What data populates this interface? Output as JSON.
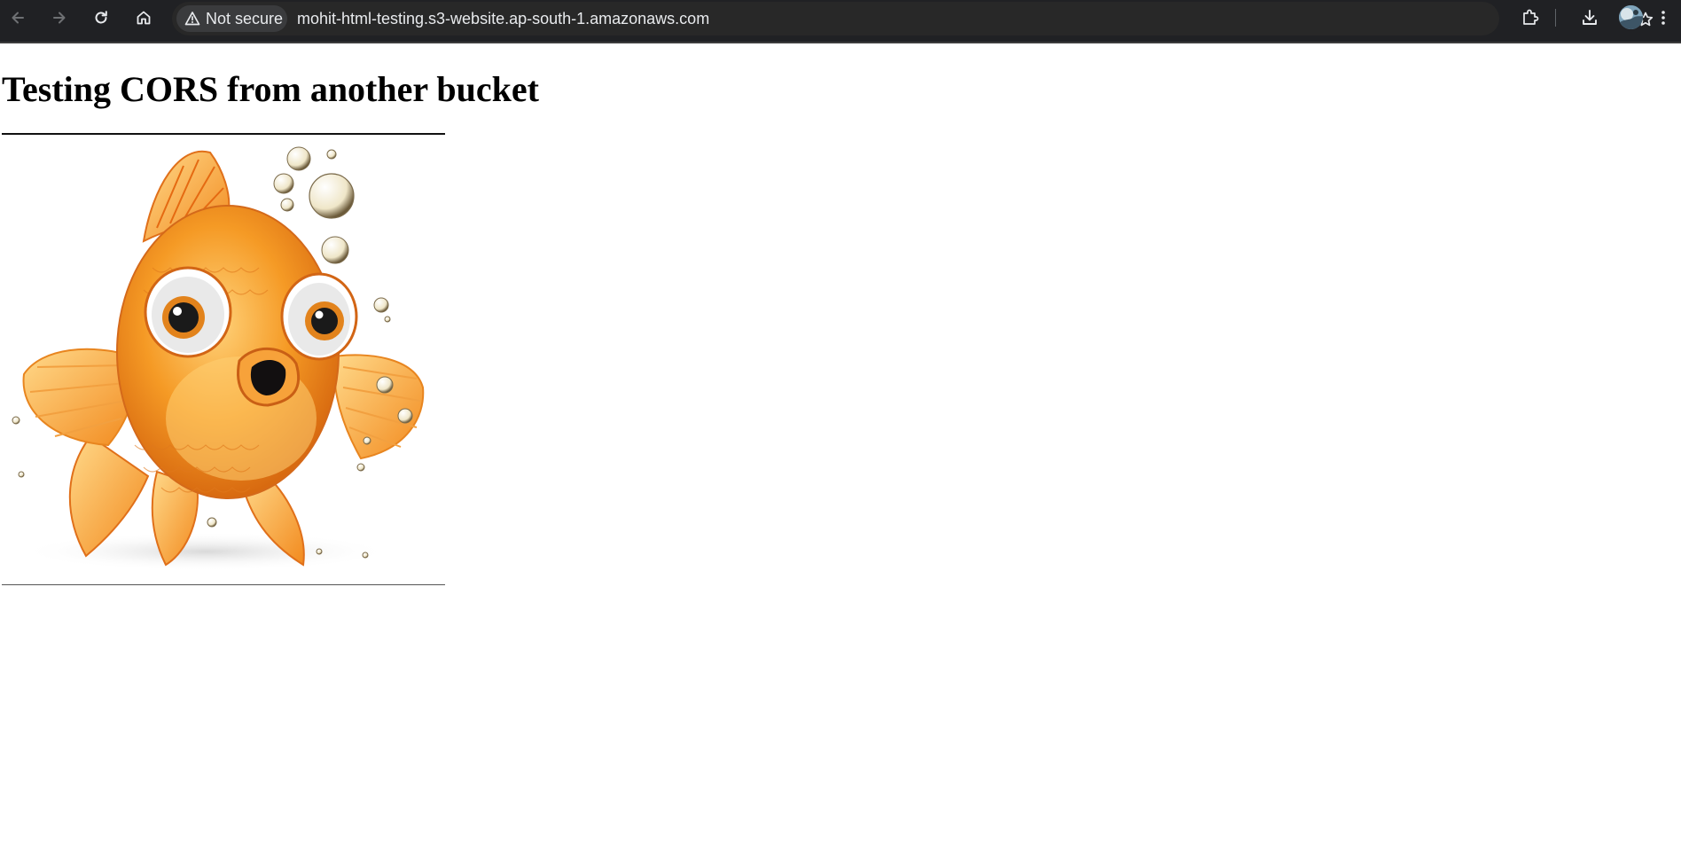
{
  "browser": {
    "security_label": "Not secure",
    "url": "mohit-html-testing.s3-website.ap-south-1.amazonaws.com",
    "icons": {
      "back": "arrow-left-icon",
      "forward": "arrow-right-icon",
      "reload": "reload-icon",
      "home": "home-icon",
      "security": "warning-triangle-icon",
      "bookmark": "star-icon",
      "extensions": "puzzle-icon",
      "downloads": "download-icon",
      "profile": "avatar",
      "menu": "kebab-menu-icon"
    },
    "colors": {
      "toolbar_bg": "#202124",
      "omnibox_bg": "#282828",
      "text": "#e8eaed",
      "icon_disabled": "#6e7073"
    }
  },
  "page": {
    "heading": "Testing CORS from another bucket",
    "image": {
      "subject": "cartoon orange goldfish with bubbles",
      "colors": {
        "body": "#f59a25",
        "fin": "#ffb94d",
        "eye": "#ffffff",
        "bubble": "#efe6c8"
      }
    }
  }
}
